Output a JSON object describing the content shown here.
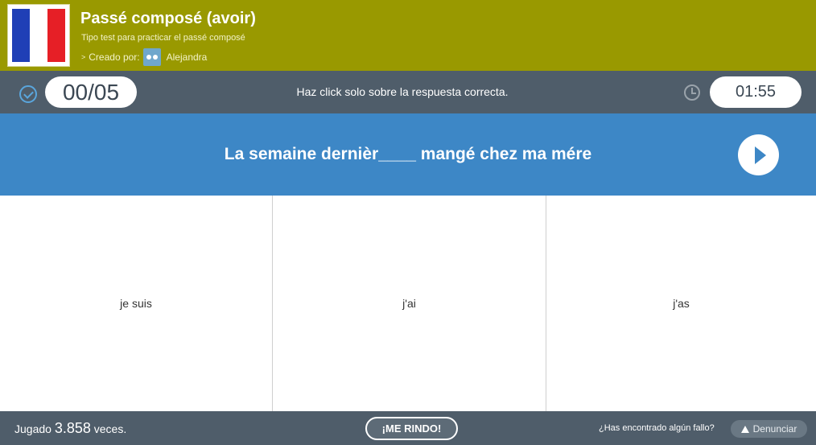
{
  "colors": {
    "header_bg": "#999900",
    "status_bg": "#4f5d6a",
    "question_bg": "#3d87c6",
    "accent": "#5aa6dd"
  },
  "header": {
    "flag": "france-flag",
    "title": "Passé composé (avoir)",
    "subtitle": "Tipo test para practicar el passé composé",
    "creator_label": "Creado por:",
    "creator_name": "Alejandra",
    "creator_avatar": "owl-avatar"
  },
  "status": {
    "score": "00/05",
    "instruction": "Haz click solo sobre la respuesta correcta.",
    "timer": "01:55"
  },
  "question": {
    "text": "La semaine dernièr____ mangé chez ma mére"
  },
  "answers": [
    {
      "label": "je suis"
    },
    {
      "label": "j'ai"
    },
    {
      "label": "j'as"
    }
  ],
  "footer": {
    "played_prefix": "Jugado",
    "played_count": "3.858",
    "played_suffix": "veces.",
    "give_up": "¡ME RINDO!",
    "found_error": "¿Has encontrado algún fallo?",
    "report": "Denunciar"
  }
}
